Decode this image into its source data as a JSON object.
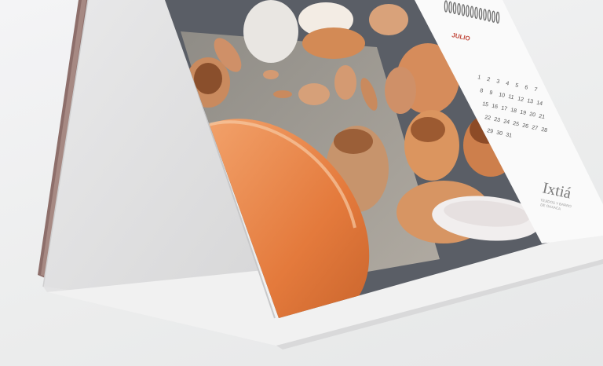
{
  "photo": {
    "subject": "Desk tent calendar with photo of clay pottery"
  },
  "calendar": {
    "month_label": "JULIO",
    "days": [
      "1",
      "2",
      "3",
      "4",
      "5",
      "6",
      "7",
      "8",
      "9",
      "10",
      "11",
      "12",
      "13",
      "14",
      "15",
      "16",
      "17",
      "18",
      "19",
      "20",
      "21",
      "22",
      "23",
      "24",
      "25",
      "26",
      "27",
      "28",
      "29",
      "30",
      "31"
    ]
  },
  "brand": {
    "logo_text": "Ixtiá",
    "tagline_line1": "TEJIDOS Y BARRO",
    "tagline_line2": "DE OAXACA"
  },
  "colors": {
    "background": "#efeff0",
    "board": "#e3e3e4",
    "clay": "#d9946a",
    "bowl_orange": "#e7864a",
    "accent_red": "#c0473a"
  }
}
